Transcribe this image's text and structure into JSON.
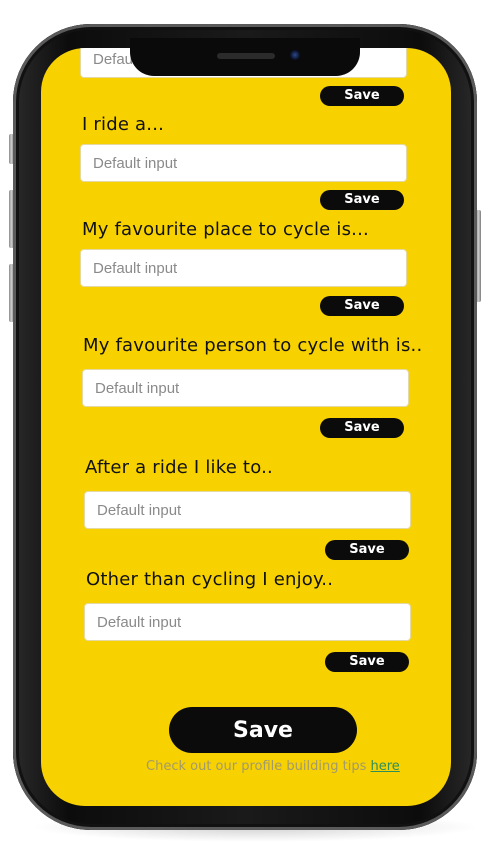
{
  "form": {
    "placeholder": "Default input",
    "save_small_label": "Save",
    "fields": [
      {
        "label": "",
        "save": "Save"
      },
      {
        "label": "I ride a...",
        "save": "Save"
      },
      {
        "label": "My favourite place to cycle is...",
        "save": "Save"
      },
      {
        "label": "My favourite person to cycle with is..",
        "save": "Save"
      },
      {
        "label": "After a ride I like to..",
        "save": "Save"
      },
      {
        "label": "Other than cycling I enjoy..",
        "save": "Save"
      }
    ]
  },
  "footer": {
    "save_label": "Save",
    "tips_text": "Check out our profile building tips",
    "tips_link": "here"
  },
  "colors": {
    "screen_bg": "#f7d200",
    "button_bg": "#0b0b0b",
    "link": "#2f8f5a"
  }
}
